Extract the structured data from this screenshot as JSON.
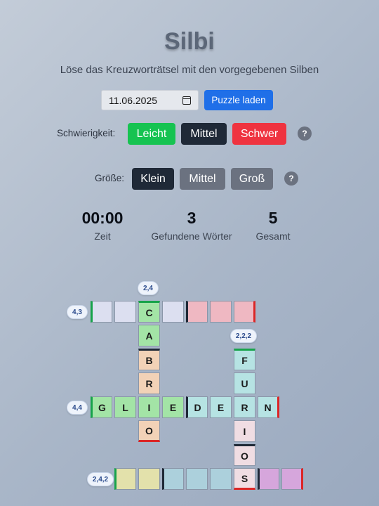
{
  "header": {
    "title": "Silbi",
    "subtitle": "Löse das Kreuzworträtsel mit den vorgegebenen Silben"
  },
  "date_picker": {
    "value": "11.06.2025",
    "icon": "calendar-icon"
  },
  "load_button": {
    "label": "Puzzle laden",
    "color": "#1f6fe8"
  },
  "difficulty": {
    "label": "Schwierigkeit:",
    "options": [
      {
        "label": "Leicht",
        "color": "#16c351"
      },
      {
        "label": "Mittel",
        "color": "#1f2937"
      },
      {
        "label": "Schwer",
        "color": "#ef3340"
      }
    ],
    "help": "?"
  },
  "size": {
    "label": "Größe:",
    "options": [
      {
        "label": "Klein",
        "color": "#1f2937",
        "selected": true
      },
      {
        "label": "Mittel",
        "color": "#6b7280"
      },
      {
        "label": "Groß",
        "color": "#6b7280"
      }
    ],
    "help": "?"
  },
  "stats": {
    "time": {
      "value": "00:00",
      "label": "Zeit"
    },
    "found": {
      "value": "3",
      "label": "Gefundene Wörter"
    },
    "total": {
      "value": "5",
      "label": "Gesamt"
    }
  },
  "clues": [
    "2,4",
    "4,3",
    "2,2,2",
    "4,4",
    "2,4,2"
  ],
  "grid_letters": {
    "c": "C",
    "a": "A",
    "b": "B",
    "r": "R",
    "g": "G",
    "l": "L",
    "i": "I",
    "e": "E",
    "d": "D",
    "e2": "E",
    "r2": "R",
    "n": "N",
    "o": "O",
    "f": "F",
    "u": "U",
    "i2": "I",
    "o2": "O",
    "s": "S"
  },
  "colors": {
    "green": "#a3e4a6",
    "lavender": "#dcdff0",
    "pink": "#efb8c2",
    "peach": "#f2d2b7",
    "cyan": "#b6e3e3",
    "pale_pink": "#f0dde3",
    "khaki": "#e3e1ab",
    "light_blue": "#acd0dc",
    "violet": "#d6a6dc"
  }
}
